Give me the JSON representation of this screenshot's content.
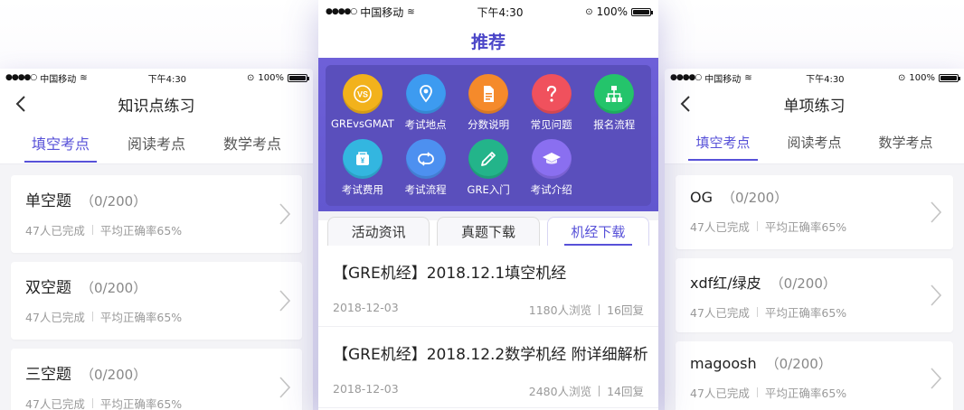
{
  "status": {
    "carrier": "中国移动",
    "time": "下午4:30",
    "battery": "100%"
  },
  "left": {
    "title": "知识点练习",
    "tabs": [
      "填空考点",
      "阅读考点",
      "数学考点"
    ],
    "cards": [
      {
        "title": "单空题",
        "count": "（0/200）",
        "done": "47人已完成",
        "rate": "平均正确率65%"
      },
      {
        "title": "双空题",
        "count": "（0/200）",
        "done": "47人已完成",
        "rate": "平均正确率65%"
      },
      {
        "title": "三空题",
        "count": "（0/200）",
        "done": "47人已完成",
        "rate": "平均正确率65%"
      }
    ]
  },
  "center": {
    "title": "推荐",
    "icons": [
      {
        "label": "GREvsGMAT",
        "icon": "vs-icon",
        "color": "#f2b21c"
      },
      {
        "label": "考试地点",
        "icon": "location-pin-icon",
        "color": "#3d9bf0"
      },
      {
        "label": "分数说明",
        "icon": "document-icon",
        "color": "#f58a2b"
      },
      {
        "label": "常见问题",
        "icon": "question-icon",
        "color": "#f0515d"
      },
      {
        "label": "报名流程",
        "icon": "org-chart-icon",
        "color": "#24c46b"
      },
      {
        "label": "考试费用",
        "icon": "wallet-icon",
        "color": "#33b6e0"
      },
      {
        "label": "考试流程",
        "icon": "cycle-icon",
        "color": "#4d90f0"
      },
      {
        "label": "GRE入门",
        "icon": "pencil-icon",
        "color": "#23b48a"
      },
      {
        "label": "考试介绍",
        "icon": "graduation-cap-icon",
        "color": "#8a6ff0"
      }
    ],
    "seg_tabs": [
      "活动资讯",
      "真题下载",
      "机经下载"
    ],
    "articles": [
      {
        "title": "【GRE机经】2018.12.1填空机经",
        "date": "2018-12-03",
        "views": "1180人浏览",
        "replies": "16回复"
      },
      {
        "title": "【GRE机经】2018.12.2数学机经 附详细解析",
        "date": "2018-12-03",
        "views": "2480人浏览",
        "replies": "14回复"
      }
    ]
  },
  "right": {
    "title": "单项练习",
    "tabs": [
      "填空考点",
      "阅读考点",
      "数学考点"
    ],
    "cards": [
      {
        "title": "OG",
        "count": "（0/200）",
        "done": "47人已完成",
        "rate": "平均正确率65%"
      },
      {
        "title": "xdf红/绿皮",
        "count": "（0/200）",
        "done": "47人已完成",
        "rate": "平均正确率65%"
      },
      {
        "title": "magoosh",
        "count": "（0/200）",
        "done": "47人已完成",
        "rate": "平均正确率65%"
      }
    ]
  }
}
